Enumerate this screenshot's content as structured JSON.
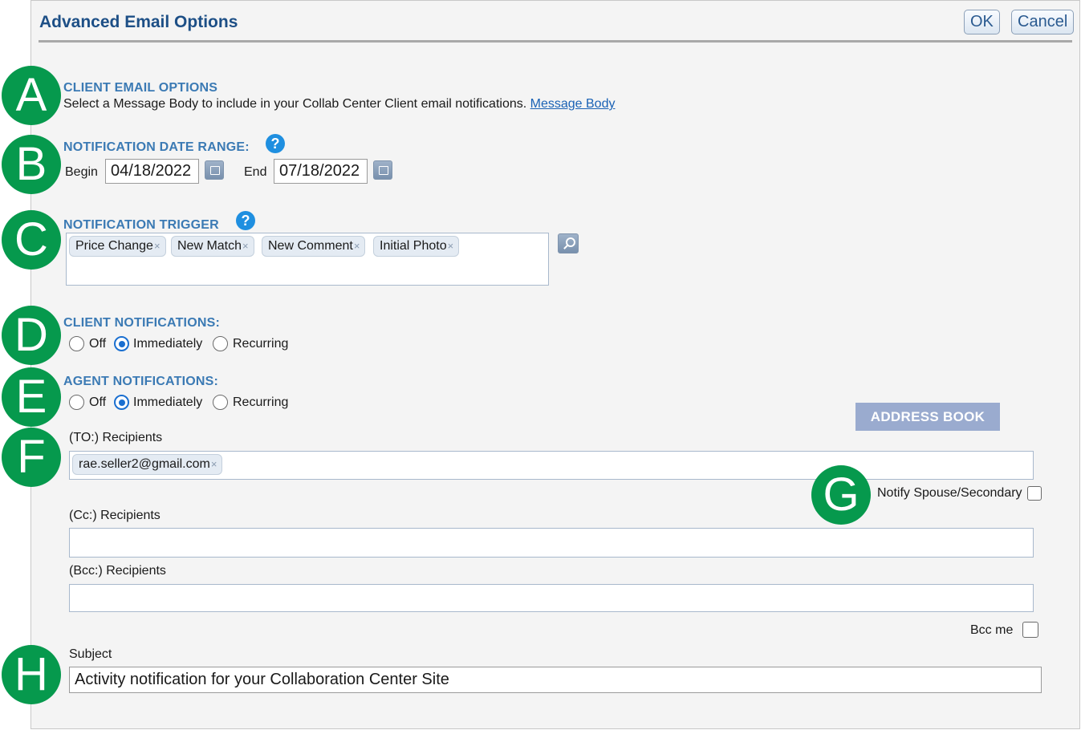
{
  "header": {
    "title": "Advanced Email Options",
    "ok_label": "OK",
    "cancel_label": "Cancel"
  },
  "client_email_options": {
    "title": "CLIENT EMAIL OPTIONS",
    "description": "Select a Message Body to include in your Collab Center Client email notifications.",
    "link_label": "Message Body"
  },
  "date_range": {
    "title": "NOTIFICATION DATE RANGE:",
    "help": "?",
    "begin_label": "Begin",
    "begin_value": "04/18/2022",
    "end_label": "End",
    "end_value": "07/18/2022"
  },
  "trigger": {
    "title": "NOTIFICATION TRIGGER",
    "help": "?",
    "tags": [
      "Price Change",
      "New Match",
      "New Comment",
      "Initial Photo"
    ],
    "remove_glyph": "×"
  },
  "client_notifications": {
    "title": "CLIENT NOTIFICATIONS:",
    "options": [
      "Off",
      "Immediately",
      "Recurring"
    ],
    "selected": "Immediately"
  },
  "agent_notifications": {
    "title": "AGENT NOTIFICATIONS:",
    "options": [
      "Off",
      "Immediately",
      "Recurring"
    ],
    "selected": "Immediately"
  },
  "recipients": {
    "address_book_label": "ADDRESS BOOK",
    "to_label": "(TO:) Recipients",
    "to_tags": [
      "rae.seller2@gmail.com"
    ],
    "notify_spouse_label": "Notify Spouse/Secondary",
    "cc_label": "(Cc:) Recipients",
    "bcc_label": "(Bcc:) Recipients",
    "bcc_me_label": "Bcc me"
  },
  "subject": {
    "label": "Subject",
    "value": "Activity notification for your Collaboration Center Site"
  },
  "badges": [
    "A",
    "B",
    "C",
    "D",
    "E",
    "F",
    "G",
    "H"
  ],
  "colors": {
    "accent": "#1d4f86",
    "section_title": "#3b7ab4",
    "badge": "#06994d",
    "link": "#1a62b5"
  },
  "icons": [
    "help-icon",
    "calendar-icon",
    "search-icon",
    "close-icon"
  ]
}
